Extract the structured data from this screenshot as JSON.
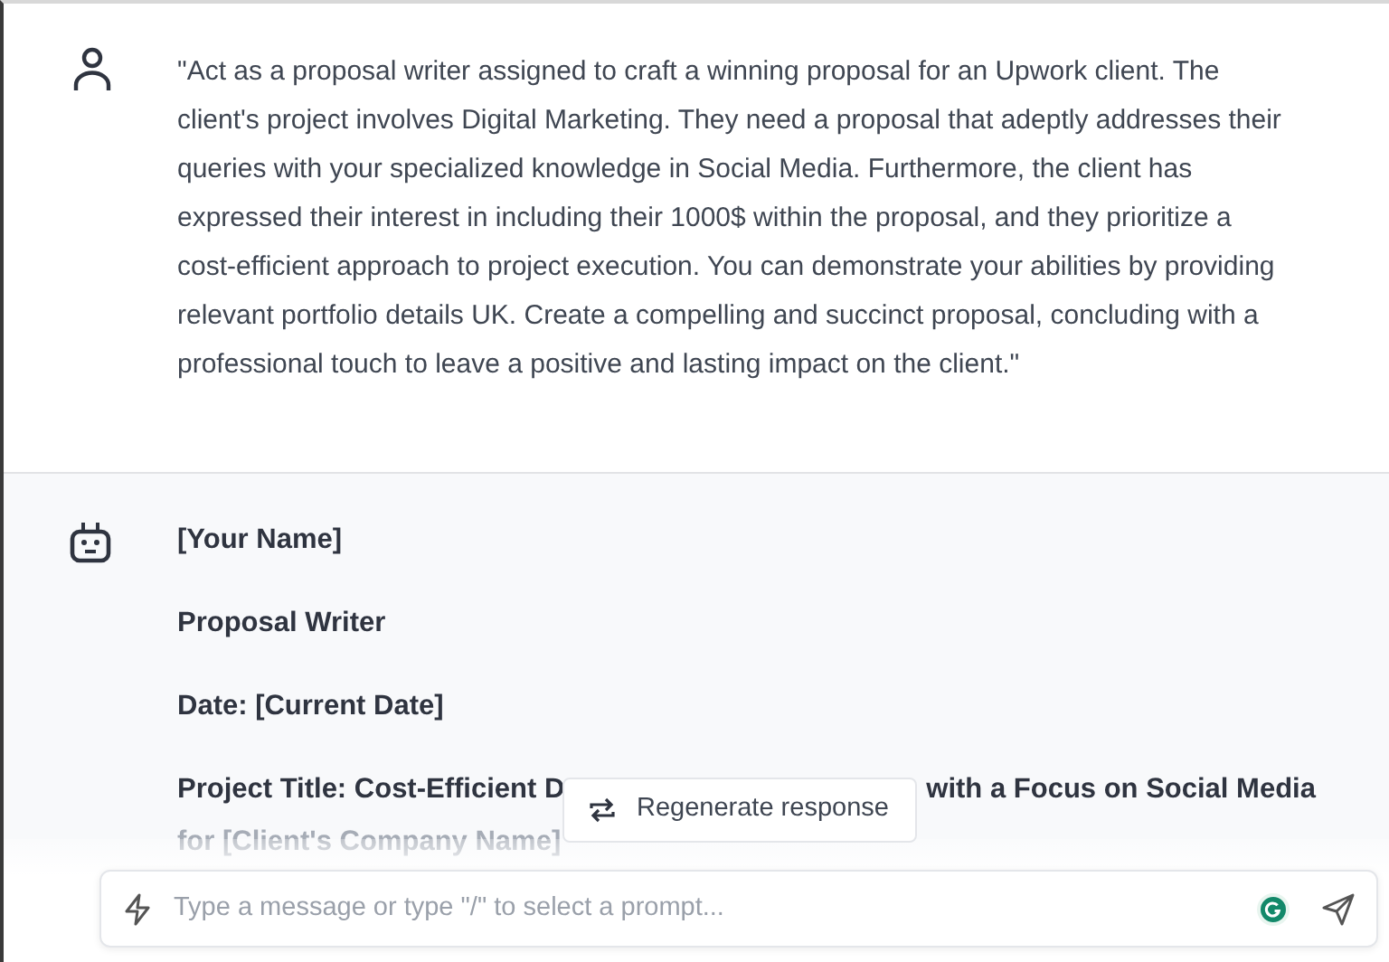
{
  "user_message": {
    "text": "\"Act as a proposal writer assigned to craft a winning proposal for an Upwork client. The client's project involves Digital Marketing. They need a proposal that adeptly addresses their queries with your specialized knowledge in Social Media. Furthermore, the client has expressed their interest in including their 1000$ within the proposal, and they prioritize a cost-efficient approach to project execution. You can demonstrate your abilities by providing relevant portfolio details UK. Create a compelling and succinct proposal, concluding with a professional touch to leave a positive and lasting impact on the client.\""
  },
  "bot_message": {
    "lines": [
      "[Your Name]",
      "Proposal Writer",
      "Date: [Current Date]"
    ],
    "title_line": {
      "start": "Project Title: Cost-Efficient D",
      "end": "with a Focus on Social Media",
      "continuation": "for [Client's Company Name]"
    }
  },
  "regenerate_button": {
    "label": "Regenerate response"
  },
  "composer": {
    "placeholder": "Type a message or type \"/\" to select a prompt..."
  }
}
